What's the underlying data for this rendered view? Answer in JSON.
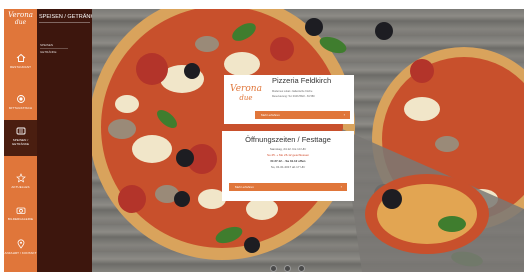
{
  "brand": {
    "line1": "Verona",
    "line2": "due"
  },
  "rail": {
    "items": [
      {
        "label": "Restaurant",
        "icon": "home-icon"
      },
      {
        "label": "Mittagstisch",
        "icon": "plate-icon"
      },
      {
        "label": "Speisen / Getränke",
        "icon": "menu-icon",
        "active": true
      },
      {
        "label": "Aktuelles",
        "icon": "star-icon"
      },
      {
        "label": "Bildergalerie",
        "icon": "camera-icon"
      },
      {
        "label": "Anfahrt / Kontakt",
        "icon": "pin-icon"
      }
    ]
  },
  "panel": {
    "title": "SPEISEN / GETRÄNKE",
    "links": [
      "SPEISEN",
      "GETRÄNKE"
    ]
  },
  "card1": {
    "title": "Pizzeria Feldkirch",
    "text1": "Modernes Lokal • Italienische Küche",
    "text2": "Reservierung: Tel. 0043-5522 - 81 580",
    "button": "Mehr erfahren"
  },
  "card2": {
    "title": "Öffnungszeiten / Festtage",
    "r1": "Samstag, 24.12. bis 14 Uhr",
    "r2": "So 25. + Mo 26.12 geschlossen",
    "r3": "Di 27.12. - Sa 31.12 offen",
    "r4": "So, 01.01.2017 ab 17 Uhr",
    "button": "Mehr erfahren"
  },
  "colors": {
    "accent": "#e0763a",
    "panel": "#3d160d",
    "active": "#4a1e10"
  },
  "slider": {
    "dots": 3
  }
}
